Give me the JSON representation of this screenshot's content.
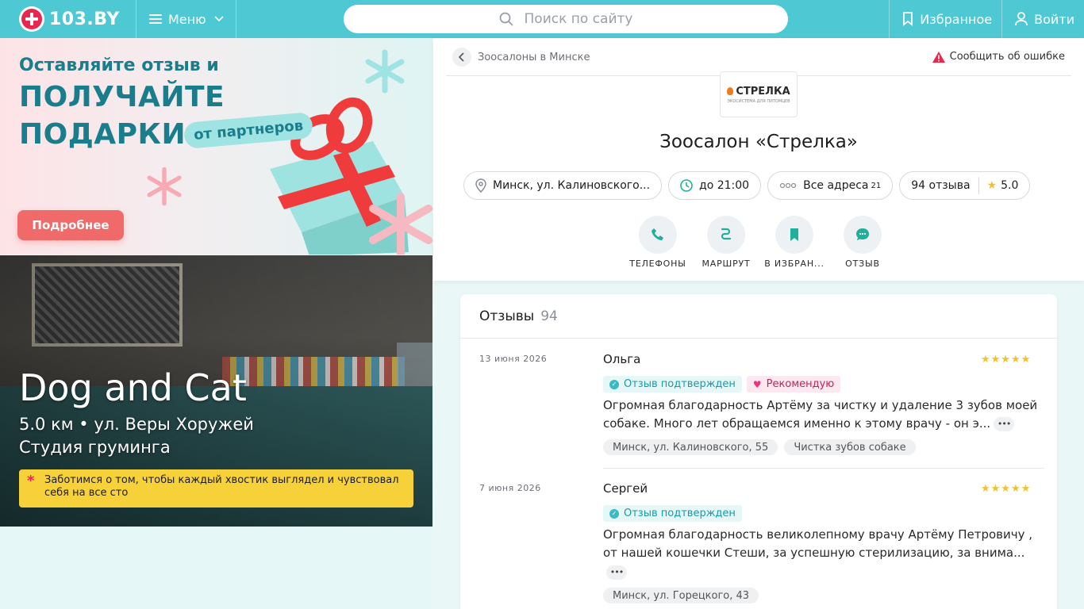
{
  "header": {
    "logo_text": "103.BY",
    "menu_label": "Меню",
    "search_placeholder": "Поиск по сайту",
    "favorites_label": "Избранное",
    "login_label": "Войти",
    "accent_color": "#4ec9d4"
  },
  "promo": {
    "line1": "Оставляйте отзыв и",
    "line2": "ПОЛУЧАЙТЕ",
    "line3": "ПОДАРКИ",
    "tag": "от партнеров",
    "button": "Подробнее"
  },
  "salon_ad": {
    "name": "Dog and Cat",
    "meta": "5.0 км • ул. Веры Хоружей",
    "type": "Студия груминга",
    "note": "Заботимся о том, чтобы каждый хвостик выглядел и чувствовал себя на все сто"
  },
  "card": {
    "breadcrumb": "Зоосалоны в Минске",
    "report": "Сообщить об ошибке",
    "logo_main": "СТРЕЛКА",
    "logo_sub": "ЭКОСИСТЕМА ДЛЯ ПИТОМЦЕВ",
    "title": "Зоосалон «Стрелка»",
    "address": "Минск, ул. Калиновского...",
    "hours": "до 21:00",
    "all_addresses": "Все адреса",
    "addresses_count": "21",
    "reviews_count": "94 отзыва",
    "rating": "5.0",
    "actions": [
      {
        "label": "ТЕЛЕФОНЫ",
        "icon": "phone-icon"
      },
      {
        "label": "МАРШРУТ",
        "icon": "route-icon"
      },
      {
        "label": "В ИЗБРАН...",
        "icon": "bookmark-icon"
      },
      {
        "label": "ОТЗЫВ",
        "icon": "chat-icon"
      }
    ]
  },
  "reviews": {
    "title": "Отзывы",
    "count": "94",
    "items": [
      {
        "date": "13 июня 2026",
        "author": "Ольга",
        "stars": "★★★★★",
        "verified": "Отзыв подтвержден",
        "recommend": "Рекомендую",
        "text": "Огромная благодарность Артёму за чистку и удаление 3 зубов моей собаке. Много лет обращаемся именно к этому врачу - он э...",
        "tags": [
          "Минск, ул. Калиновского, 55",
          "Чистка зубов собаке"
        ]
      },
      {
        "date": "7 июня 2026",
        "author": "Сергей",
        "stars": "★★★★★",
        "verified": "Отзыв подтвержден",
        "text": "Огромная благодарность великолепному врачу Артёму Петровичу , от нашей кошечки Стеши, за успешную стерилизацию, за внима...",
        "tags": [
          "Минск, ул. Горецкого, 43"
        ]
      }
    ]
  }
}
